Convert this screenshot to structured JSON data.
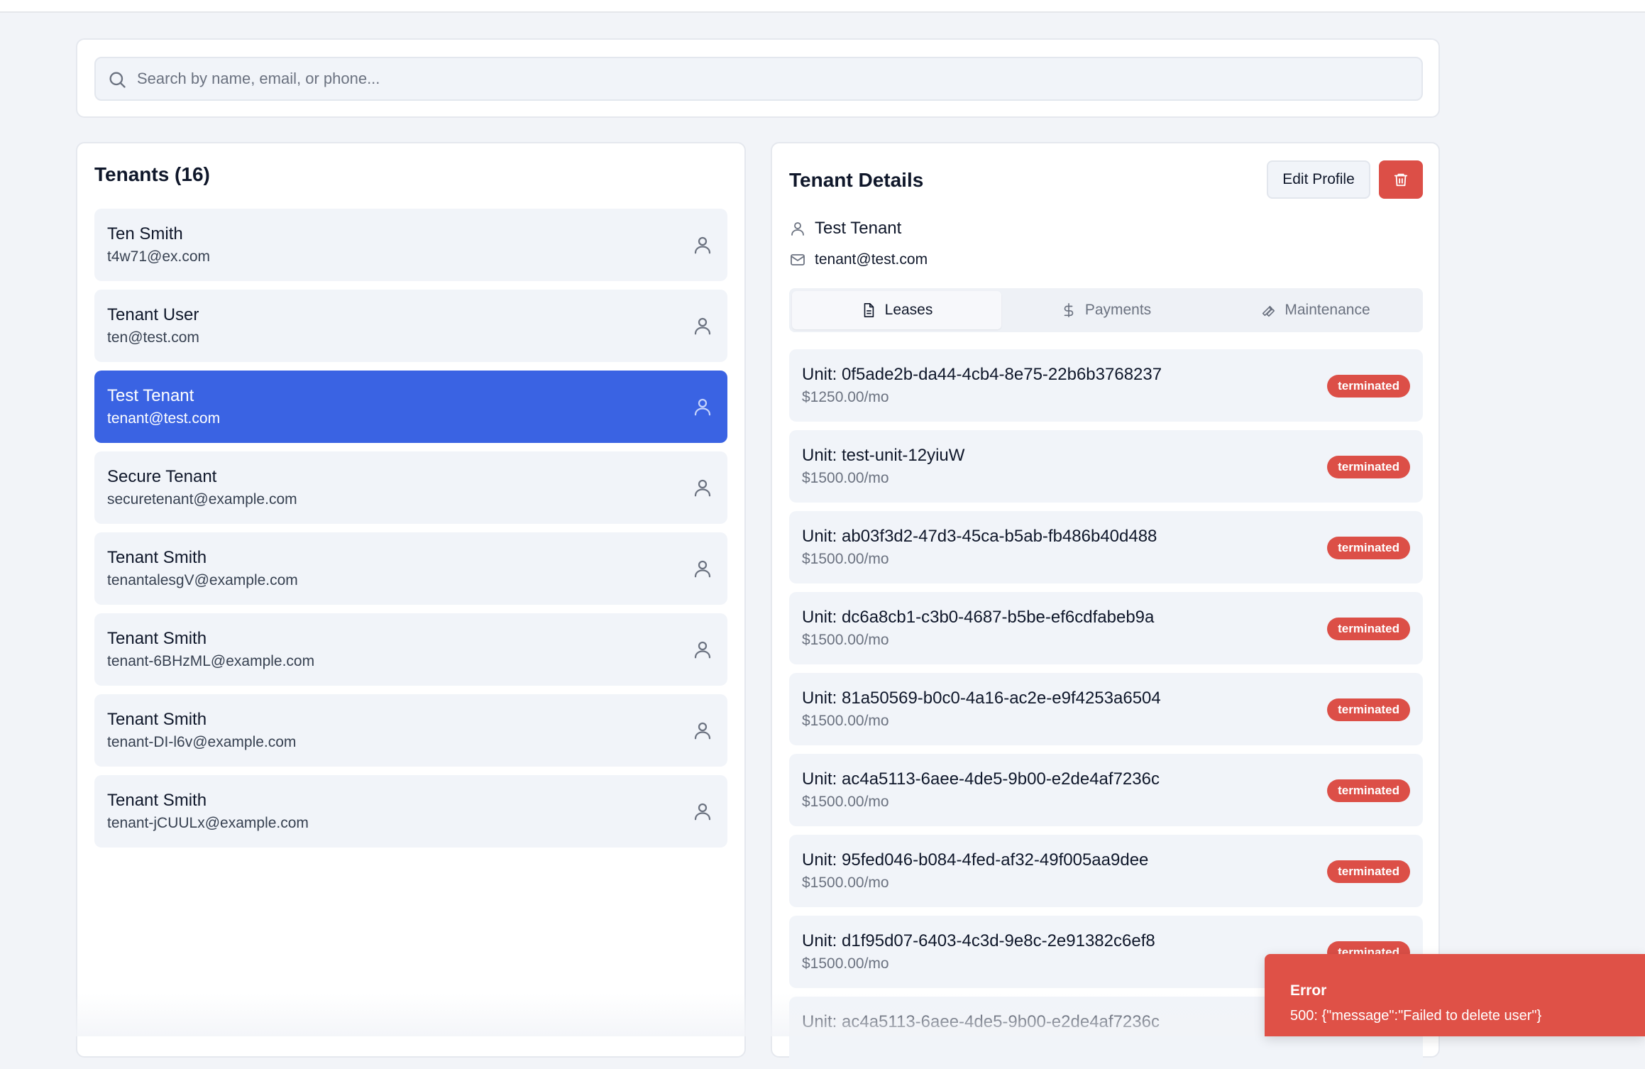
{
  "search": {
    "placeholder": "Search by name, email, or phone..."
  },
  "tenants_panel": {
    "title": "Tenants (16)",
    "items": [
      {
        "name": "Ten Smith",
        "email": "t4w71@ex.com"
      },
      {
        "name": "Tenant User",
        "email": "ten@test.com"
      },
      {
        "name": "Test Tenant",
        "email": "tenant@test.com",
        "selected": true
      },
      {
        "name": "Secure Tenant",
        "email": "securetenant@example.com"
      },
      {
        "name": "Tenant Smith",
        "email": "tenantalesgV@example.com"
      },
      {
        "name": "Tenant Smith",
        "email": "tenant-6BHzML@example.com"
      },
      {
        "name": "Tenant Smith",
        "email": "tenant-DI-l6v@example.com"
      },
      {
        "name": "Tenant Smith",
        "email": "tenant-jCUULx@example.com"
      }
    ]
  },
  "details": {
    "title": "Tenant Details",
    "edit_label": "Edit Profile",
    "name": "Test Tenant",
    "email": "tenant@test.com",
    "tabs": [
      {
        "label": "Leases",
        "icon": "file-text-icon",
        "active": true
      },
      {
        "label": "Payments",
        "icon": "dollar-icon"
      },
      {
        "label": "Maintenance",
        "icon": "wrench-icon"
      }
    ],
    "leases": [
      {
        "unit": "Unit: 0f5ade2b-da44-4cb4-8e75-22b6b3768237",
        "rent": "$1250.00/mo",
        "status": "terminated"
      },
      {
        "unit": "Unit: test-unit-12yiuW",
        "rent": "$1500.00/mo",
        "status": "terminated"
      },
      {
        "unit": "Unit: ab03f3d2-47d3-45ca-b5ab-fb486b40d488",
        "rent": "$1500.00/mo",
        "status": "terminated"
      },
      {
        "unit": "Unit: dc6a8cb1-c3b0-4687-b5be-ef6cdfabeb9a",
        "rent": "$1500.00/mo",
        "status": "terminated"
      },
      {
        "unit": "Unit: 81a50569-b0c0-4a16-ac2e-e9f4253a6504",
        "rent": "$1500.00/mo",
        "status": "terminated"
      },
      {
        "unit": "Unit: ac4a5113-6aee-4de5-9b00-e2de4af7236c",
        "rent": "$1500.00/mo",
        "status": "terminated"
      },
      {
        "unit": "Unit: 95fed046-b084-4fed-af32-49f005aa9dee",
        "rent": "$1500.00/mo",
        "status": "terminated"
      },
      {
        "unit": "Unit: d1f95d07-6403-4c3d-9e8c-2e91382c6ef8",
        "rent": "$1500.00/mo",
        "status": "terminated"
      },
      {
        "unit": "Unit: ac4a5113-6aee-4de5-9b00-e2de4af7236c",
        "rent": "",
        "status": ""
      }
    ]
  },
  "toast": {
    "title": "Error",
    "message": "500: {\"message\":\"Failed to delete user\"}"
  },
  "colors": {
    "accent": "#3a63e3",
    "danger": "#dc4f47",
    "toast": "#df5147",
    "surface": "#f1f4f9",
    "background": "#f2f4f8"
  }
}
